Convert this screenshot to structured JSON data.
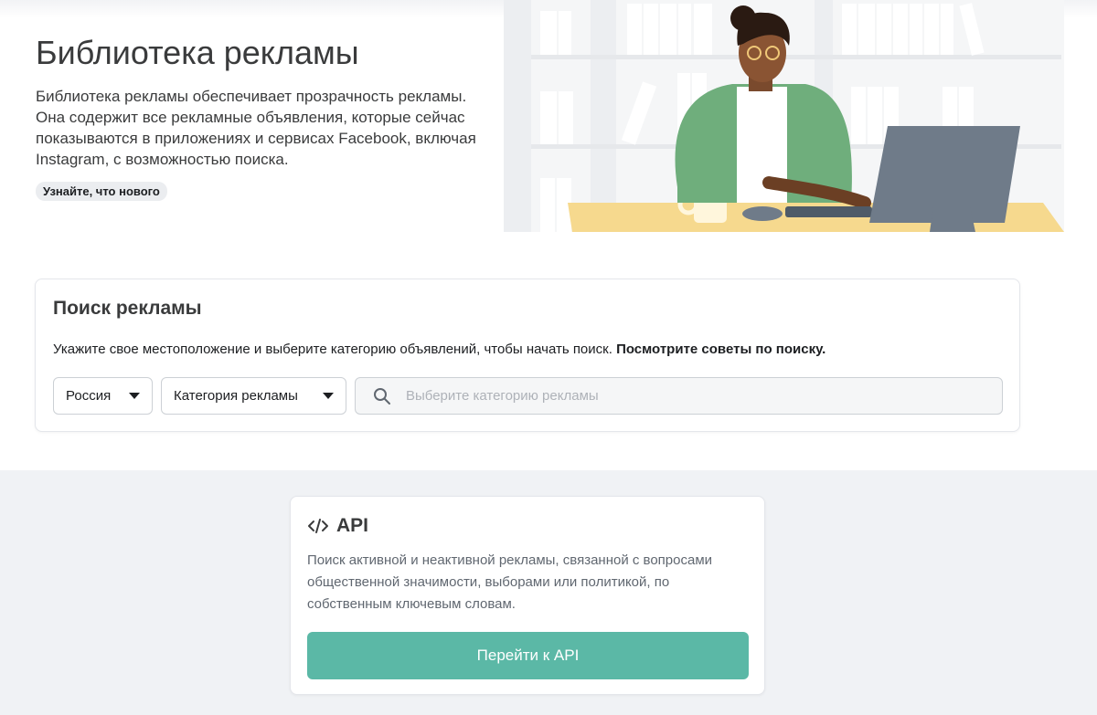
{
  "hero": {
    "title": "Библиотека рекламы",
    "description": "Библиотека рекламы обеспечивает прозрачность рекламы. Она содержит все рекламные объявления, которые сейчас показываются в приложениях и сервисах Facebook, включая Instagram, с возможностью поиска.",
    "whats_new": "Узнайте, что нового"
  },
  "search": {
    "title": "Поиск рекламы",
    "hint": "Укажите свое местоположение и выберите категорию объявлений, чтобы начать поиск.",
    "hint_link": "Посмотрите советы по поиску.",
    "country": "Россия",
    "category": "Категория рекламы",
    "placeholder": "Выберите категорию рекламы"
  },
  "api": {
    "icon": "</>",
    "title": "API",
    "description": "Поиск активной и неактивной рекламы, связанной с вопросами общественной значимости, выборами или политикой, по собственным ключевым словам.",
    "button": "Перейти к API"
  },
  "colors": {
    "accent": "#5bb8a6",
    "page_bg": "#f0f2f5"
  }
}
